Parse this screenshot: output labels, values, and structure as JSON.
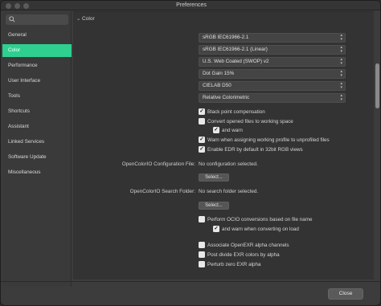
{
  "window": {
    "title": "Preferences"
  },
  "sidebar": {
    "search_placeholder": "",
    "items": [
      {
        "label": "General"
      },
      {
        "label": "Color"
      },
      {
        "label": "Performance"
      },
      {
        "label": "User Interface"
      },
      {
        "label": "Tools"
      },
      {
        "label": "Shortcuts"
      },
      {
        "label": "Assistant"
      },
      {
        "label": "Linked Services"
      },
      {
        "label": "Software Update"
      },
      {
        "label": "Miscellaneous"
      }
    ],
    "active": "Color"
  },
  "color": {
    "section_title": "Color",
    "profiles": [
      {
        "label": "RGB Color Profile:",
        "value": "sRGB IEC61966-2.1"
      },
      {
        "label": "32bit RGB Color Profile:",
        "value": "sRGB IEC61966-2.1 (Linear)"
      },
      {
        "label": "CMYK Color Profile:",
        "value": "U.S. Web Coated (SWOP) v2"
      },
      {
        "label": "Grayscale Color Profile:",
        "value": "Dot Gain 15%"
      },
      {
        "label": "LAB Color Profile:",
        "value": "CIELAB D50"
      },
      {
        "label": "Rendering Intent:",
        "value": "Relative Colorimetric"
      }
    ],
    "checkboxes": [
      {
        "label": "Black point compensation",
        "checked": true
      },
      {
        "label": "Convert opened files to working space",
        "checked": false
      },
      {
        "label": "and warn",
        "checked": true
      },
      {
        "label": "Warn when assigning working profile to unprofiled files",
        "checked": true
      },
      {
        "label": "Enable EDR by default in 32bit RGB views",
        "checked": true
      }
    ],
    "ocio_config": {
      "label": "OpenColorIO Configuration File:",
      "status": "No configuration selected.",
      "button": "Select..."
    },
    "ocio_search": {
      "label": "OpenColorIO Search Folder:",
      "status": "No search folder selected.",
      "button": "Select..."
    },
    "ocio_checkboxes": [
      {
        "label": "Perform OCIO conversions based on file name",
        "checked": false
      },
      {
        "label": "and warn when converting on load",
        "checked": true
      }
    ],
    "exr_checkboxes": [
      {
        "label": "Associate OpenEXR alpha channels",
        "checked": false
      },
      {
        "label": "Post divide EXR colors by alpha",
        "checked": false
      },
      {
        "label": "Perturb zero EXR alpha",
        "checked": false
      }
    ]
  },
  "footer": {
    "close_label": "Close"
  },
  "colors": {
    "accent": "#2ecf8f",
    "background": "#3c3c3c"
  }
}
